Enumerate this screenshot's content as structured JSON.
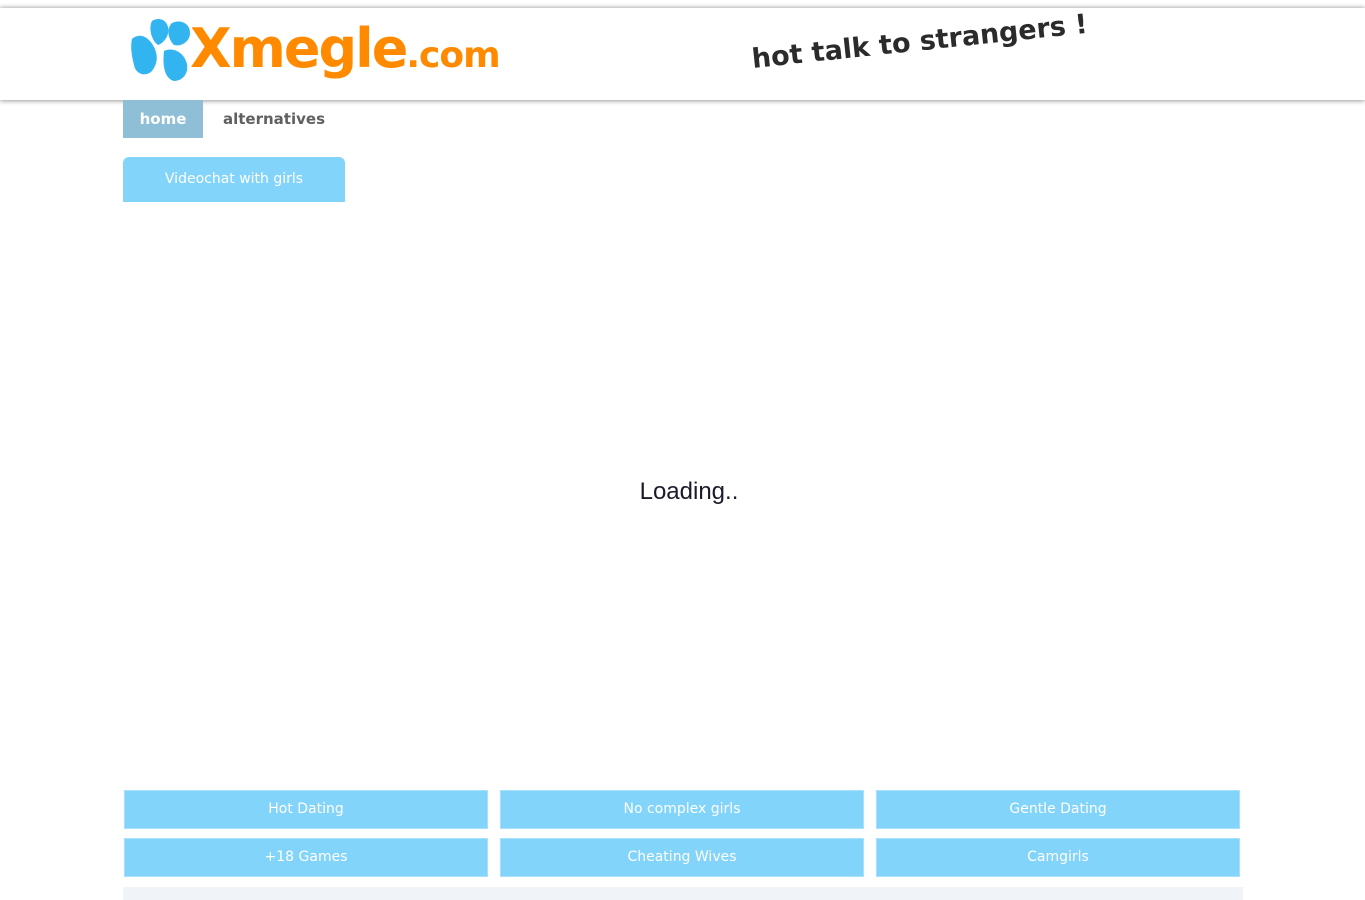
{
  "header": {
    "logo": {
      "brand": "Xmegle",
      "tld": ".com",
      "icon": "x-logo-icon",
      "brand_color": "#ff8a00",
      "icon_color": "#32b4f0"
    },
    "slogan": "hot talk to strangers !"
  },
  "nav": {
    "items": [
      {
        "label": "home",
        "active": true
      },
      {
        "label": "alternatives",
        "active": false
      }
    ],
    "active_color": "#8ebfd6"
  },
  "videochat_button": {
    "label": "Videochat with girls",
    "color": "#82d4fa"
  },
  "main": {
    "status_text": "Loading.."
  },
  "links": [
    {
      "label": "Hot Dating"
    },
    {
      "label": "No complex girls"
    },
    {
      "label": "Gentle Dating"
    },
    {
      "label": "+18 Games"
    },
    {
      "label": "Cheating Wives"
    },
    {
      "label": "Camgirls"
    }
  ]
}
